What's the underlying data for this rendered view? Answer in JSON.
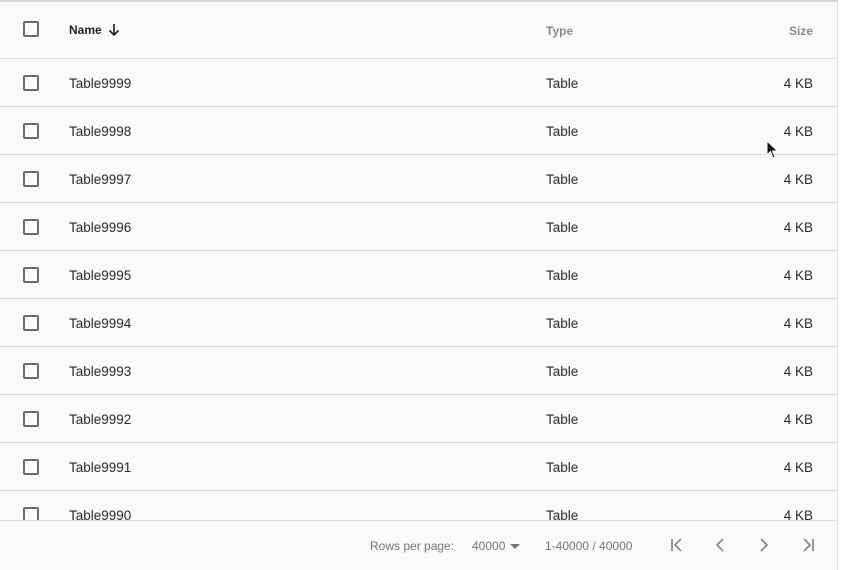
{
  "header": {
    "name_label": "Name",
    "type_label": "Type",
    "size_label": "Size"
  },
  "rows": [
    {
      "name": "Table9999",
      "type": "Table",
      "size": "4 KB"
    },
    {
      "name": "Table9998",
      "type": "Table",
      "size": "4 KB"
    },
    {
      "name": "Table9997",
      "type": "Table",
      "size": "4 KB"
    },
    {
      "name": "Table9996",
      "type": "Table",
      "size": "4 KB"
    },
    {
      "name": "Table9995",
      "type": "Table",
      "size": "4 KB"
    },
    {
      "name": "Table9994",
      "type": "Table",
      "size": "4 KB"
    },
    {
      "name": "Table9993",
      "type": "Table",
      "size": "4 KB"
    },
    {
      "name": "Table9992",
      "type": "Table",
      "size": "4 KB"
    },
    {
      "name": "Table9991",
      "type": "Table",
      "size": "4 KB"
    },
    {
      "name": "Table9990",
      "type": "Table",
      "size": "4 KB"
    }
  ],
  "footer": {
    "rows_per_page_label": "Rows per page:",
    "rows_per_page_value": "40000",
    "range_text": "1-40000 / 40000"
  },
  "icons": {
    "sort": "arrow-down-icon",
    "first_page": "first-page-icon",
    "prev_page": "chevron-left-icon",
    "next_page": "chevron-right-icon",
    "last_page": "last-page-icon"
  },
  "colors": {
    "background": "#fafafa",
    "text": "#2a2a2a",
    "muted": "#757575",
    "divider": "#d9d9d9"
  }
}
